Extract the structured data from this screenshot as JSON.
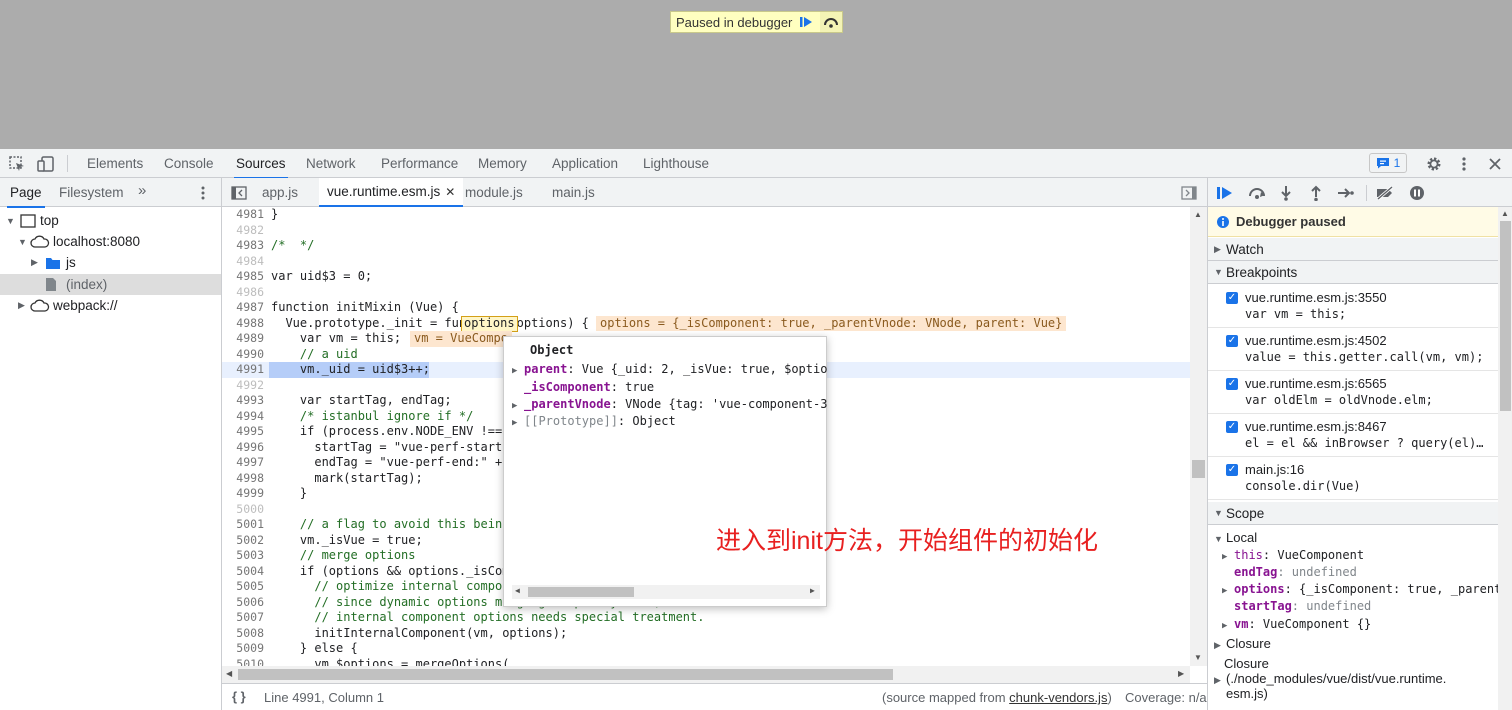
{
  "viewport": {
    "banner_text": "Paused in debugger"
  },
  "panel_tabs": [
    "Elements",
    "Console",
    "Sources",
    "Network",
    "Performance",
    "Memory",
    "Application",
    "Lighthouse"
  ],
  "issues_count": "1",
  "navigator": {
    "tabs": [
      "Page",
      "Filesystem"
    ],
    "more": "»",
    "tree": [
      "top",
      "localhost:8080",
      "js",
      "(index)",
      "webpack://"
    ]
  },
  "file_tabs": [
    "app.js",
    "vue.runtime.esm.js",
    "module.js",
    "main.js"
  ],
  "code": {
    "lines": [
      {
        "n": "4981",
        "t": "}"
      },
      {
        "n": "4982",
        "t": ""
      },
      {
        "n": "4983",
        "t": "/*  */"
      },
      {
        "n": "4984",
        "t": ""
      },
      {
        "n": "4985",
        "t": "var uid$3 = 0;"
      },
      {
        "n": "4986",
        "t": ""
      },
      {
        "n": "4987",
        "t": "function initMixin (Vue) {"
      },
      {
        "n": "4988",
        "t": "  Vue.prototype._init = function (options) {"
      },
      {
        "n": "4989",
        "t": "    var vm = this;"
      },
      {
        "n": "4990",
        "t": "    // a uid"
      },
      {
        "n": "4991",
        "t": "    vm._uid = uid$3++;"
      },
      {
        "n": "4992",
        "t": ""
      },
      {
        "n": "4993",
        "t": "    var startTag, endTag;"
      },
      {
        "n": "4994",
        "t": "    /* istanbul ignore if */"
      },
      {
        "n": "4995",
        "t": "    if (process.env.NODE_ENV !=="
      },
      {
        "n": "4996",
        "t": "      startTag = \"vue-perf-start:"
      },
      {
        "n": "4997",
        "t": "      endTag = \"vue-perf-end:\" +"
      },
      {
        "n": "4998",
        "t": "      mark(startTag);"
      },
      {
        "n": "4999",
        "t": "    }"
      },
      {
        "n": "5000",
        "t": ""
      },
      {
        "n": "5001",
        "t": "    // a flag to avoid this being"
      },
      {
        "n": "5002",
        "t": "    vm._isVue = true;"
      },
      {
        "n": "5003",
        "t": "    // merge options"
      },
      {
        "n": "5004",
        "t": "    if (options && options._isCom"
      },
      {
        "n": "5005",
        "t": "      // optimize internal compor"
      },
      {
        "n": "5006",
        "t": "      // since dynamic options merging is pretty slow, and none of the"
      },
      {
        "n": "5007",
        "t": "      // internal component options needs special treatment."
      },
      {
        "n": "5008",
        "t": "      initInternalComponent(vm, options);"
      },
      {
        "n": "5009",
        "t": "    } else {"
      },
      {
        "n": "5010",
        "t": "      vm.$options = mergeOptions("
      }
    ],
    "inline_4988": "options = {_isComponent: true, _parentVnode: VNode, parent: Vue}",
    "inline_4989": "vm = VueCompo"
  },
  "popover": {
    "title": "Object",
    "rows": [
      {
        "k": "parent",
        "v": ": Vue {_uid: 2, _isVue: true, $optio"
      },
      {
        "k": "_isComponent",
        "v": ": true"
      },
      {
        "k": "_parentVnode",
        "v": ": VNode {tag: 'vue-component-3"
      },
      {
        "k": "[[Prototype]]",
        "v": ": Object"
      }
    ]
  },
  "annotation": "进入到init方法，开始组件的初始化",
  "statusbar": {
    "position": "Line 4991, Column 1",
    "source_prefix": "(source mapped from ",
    "source_link": "chunk-vendors.js",
    "source_suffix": ")",
    "coverage": "Coverage: n/a"
  },
  "debugger": {
    "paused_msg": "Debugger paused",
    "watch": "Watch",
    "breakpoints_title": "Breakpoints",
    "breakpoints": [
      {
        "file": "vue.runtime.esm.js:3550",
        "code": "var vm = this;"
      },
      {
        "file": "vue.runtime.esm.js:4502",
        "code": "value = this.getter.call(vm, vm);"
      },
      {
        "file": "vue.runtime.esm.js:6565",
        "code": "var oldElm = oldVnode.elm;"
      },
      {
        "file": "vue.runtime.esm.js:8467",
        "code": "el = el && inBrowser ? query(el)…"
      },
      {
        "file": "main.js:16",
        "code": "console.dir(Vue)"
      }
    ],
    "scope_title": "Scope",
    "local": "Local",
    "scope_rows": [
      {
        "k": "this",
        "v": ": VueComponent"
      },
      {
        "k": "endTag",
        "v": ": undefined"
      },
      {
        "k": "options",
        "v": ": {_isComponent: true, _parent"
      },
      {
        "k": "startTag",
        "v": ": undefined"
      },
      {
        "k": "vm",
        "v": ": VueComponent {}"
      }
    ],
    "closure1": "Closure",
    "closure2": "Closure",
    "closure2_path": "(./node_modules/vue/dist/vue.runtime.",
    "closure2_path2": "esm.js)"
  },
  "colors": {
    "accent": "#1a73e8",
    "annotation": "#e82020",
    "exec_line": "#2b6be3"
  }
}
